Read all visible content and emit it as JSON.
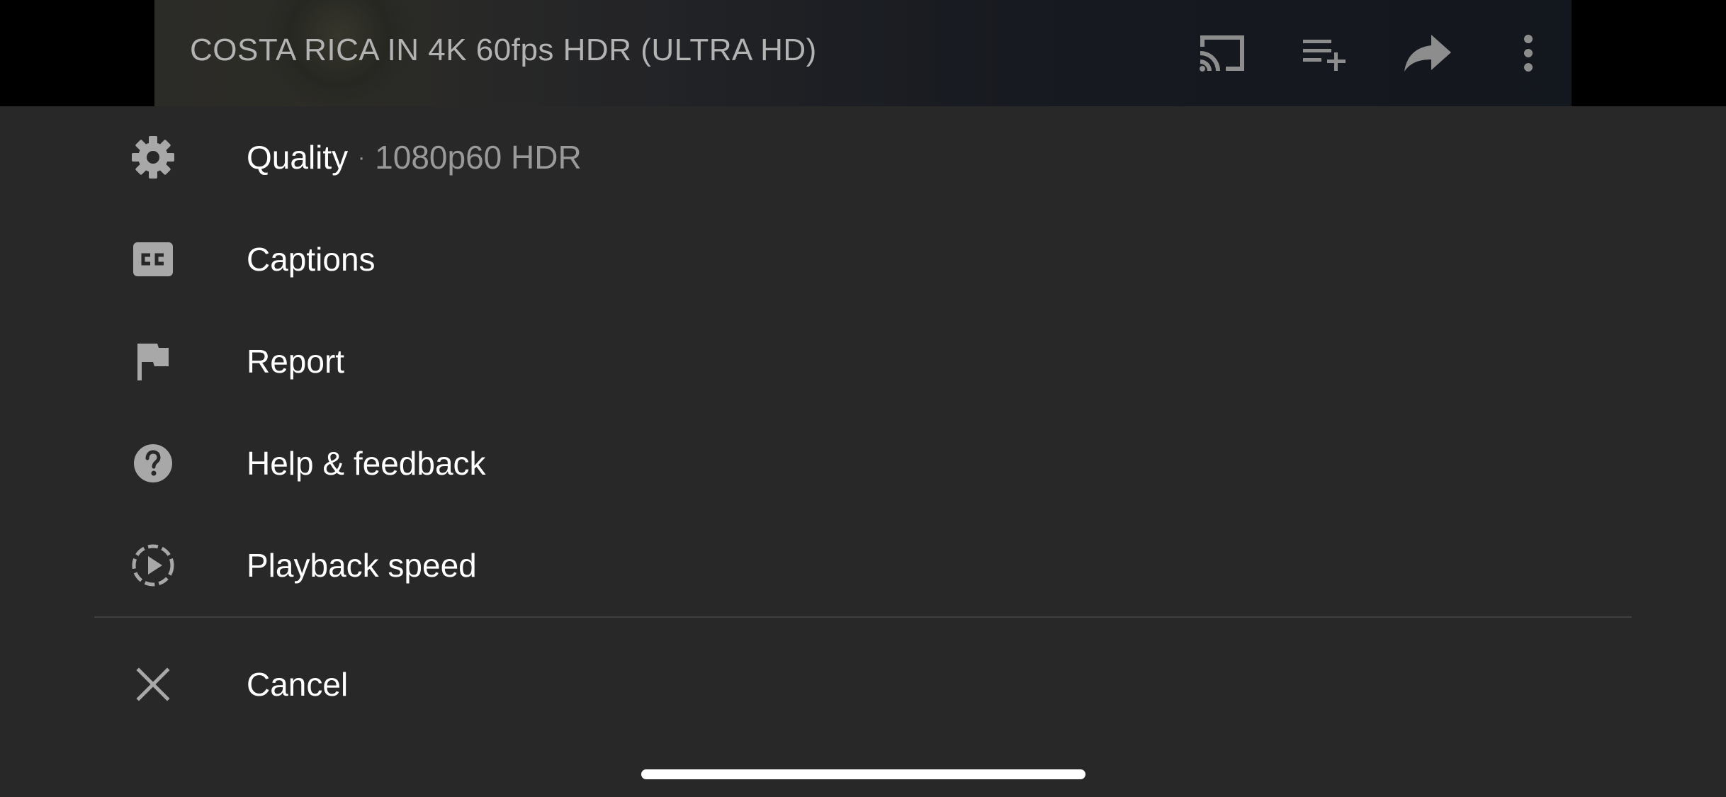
{
  "video": {
    "title": "COSTA RICA IN 4K 60fps HDR (ULTRA HD)",
    "controls": {
      "cast_icon": "cast-icon",
      "add_to_queue_icon": "playlist-add-icon",
      "share_icon": "share-icon",
      "more_icon": "more-vert-icon"
    }
  },
  "menu": {
    "items": [
      {
        "label": "Quality",
        "separator": "·",
        "value": "1080p60 HDR",
        "icon": "gear-icon"
      },
      {
        "label": "Captions",
        "icon": "closed-captions-icon"
      },
      {
        "label": "Report",
        "icon": "flag-icon"
      },
      {
        "label": "Help & feedback",
        "icon": "help-icon"
      },
      {
        "label": "Playback speed",
        "icon": "playback-speed-icon"
      }
    ],
    "cancel": {
      "label": "Cancel",
      "icon": "close-icon"
    }
  },
  "colors": {
    "sheet_background": "#282828",
    "icon_gray": "#a8a8a8",
    "text": "#ffffff",
    "secondary_text": "#9a9a9a"
  }
}
